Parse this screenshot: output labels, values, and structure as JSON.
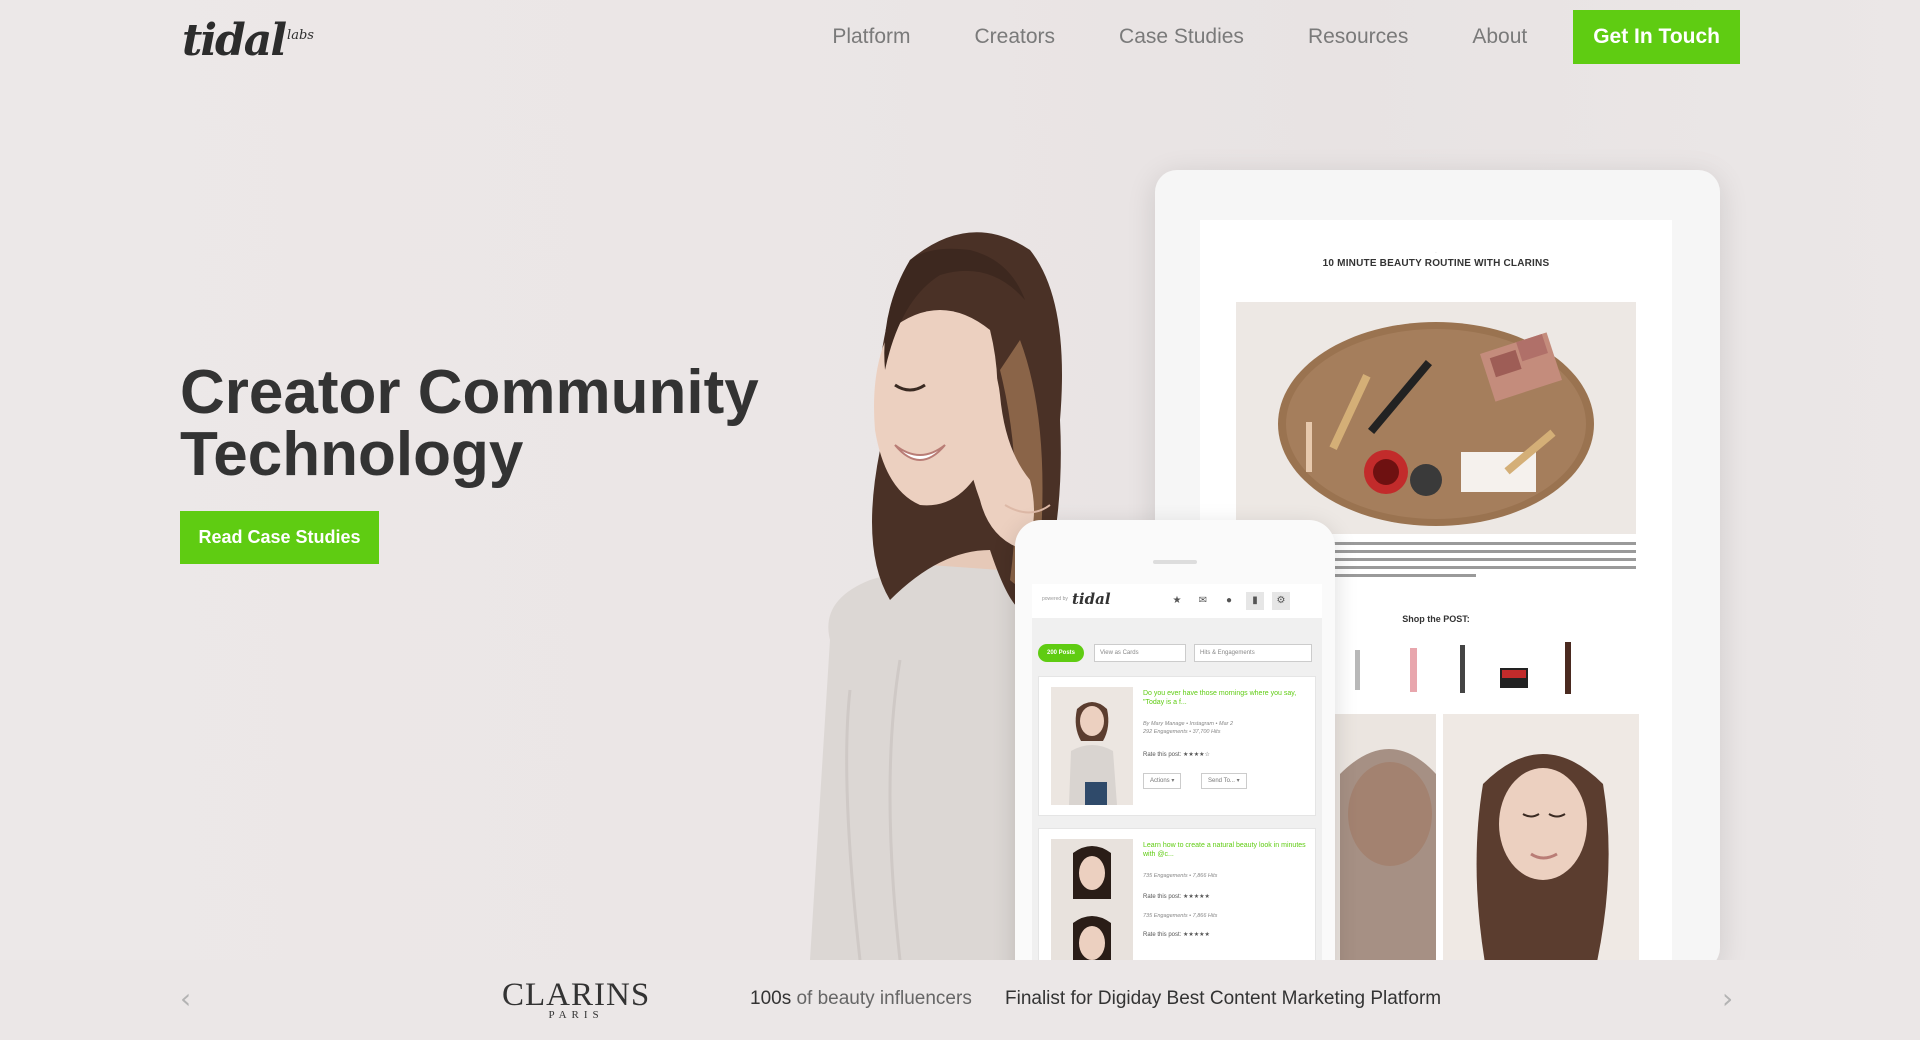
{
  "brand": {
    "logo_text": "tidal",
    "logo_sup": "labs"
  },
  "nav": {
    "items": [
      "Platform",
      "Creators",
      "Case Studies",
      "Resources",
      "About"
    ],
    "cta": "Get In Touch"
  },
  "hero": {
    "title_line1": "Creator Community",
    "title_line2": "Technology",
    "cta": "Read Case Studies"
  },
  "tablet": {
    "article_title": "10 MINUTE BEAUTY ROUTINE WITH CLARINS",
    "shop_label": "Shop the POST:"
  },
  "phone": {
    "powered_by": "powered by",
    "app_logo": "tidal",
    "pill": "200 Posts",
    "view_select": "View as Cards",
    "sort_select": "Hits & Engagements",
    "posts": [
      {
        "title": "Do you ever have those mornings where you say, \"Today is a f...",
        "meta1": "By Mary Manage • Instagram • Mar 2",
        "meta2": "292 Engagements • 37,700 Hits",
        "rate": "Rate this post: ★★★★☆",
        "actions": "Actions ▾",
        "send": "Send To... ▾"
      },
      {
        "title": "Learn how to create a natural beauty look in minutes with @c...",
        "meta1": "735 Engagements • 7,866 Hits",
        "rate": "Rate this post: ★★★★★",
        "meta2": "735 Engagements • 7,866 Hits",
        "rate2": "Rate this post: ★★★★★"
      }
    ]
  },
  "strip": {
    "prev_icon": "‹",
    "next_icon": "›",
    "partner_logo": "CLARINS",
    "partner_sub": "PARIS",
    "stat_bold": "100s",
    "stat_rest": " of beauty influencers",
    "award": "Finalist for Digiday Best Content Marketing Platform"
  },
  "colors": {
    "accent": "#5fcc12",
    "text": "#333333",
    "nav": "#7a7a7a",
    "background": "#ece8e8"
  }
}
